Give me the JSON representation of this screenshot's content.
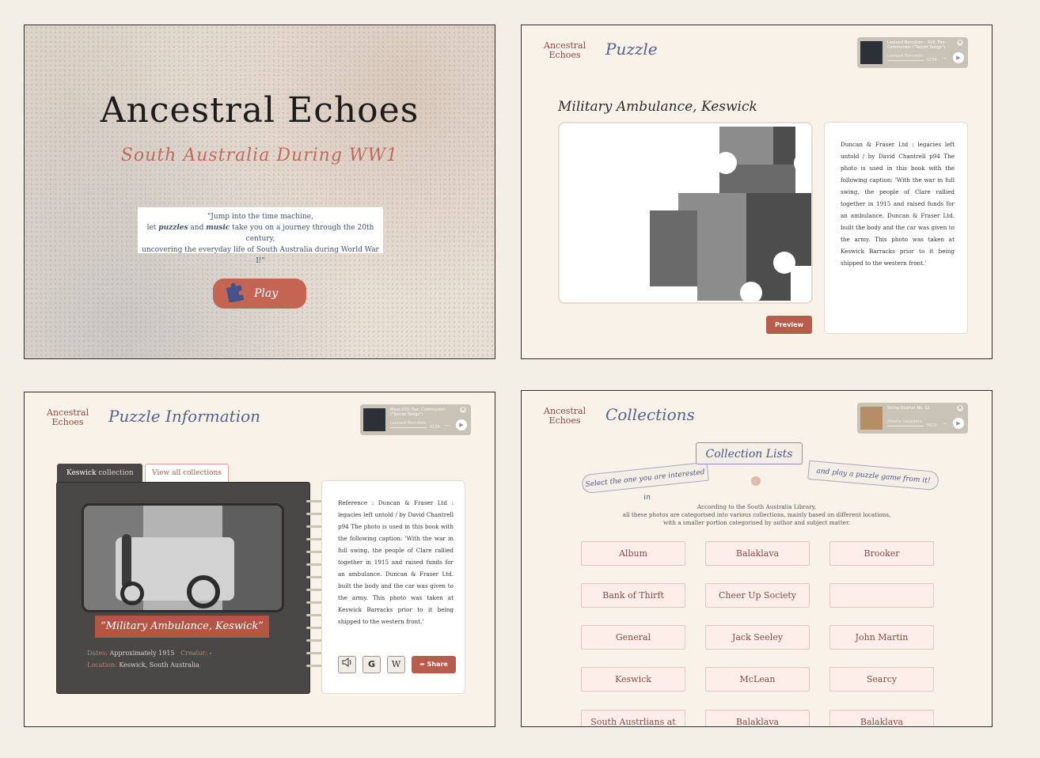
{
  "landing": {
    "title": "Ancestral Echoes",
    "subtitle": "South Australia During WW1",
    "quote_line1": "\"Jump into the time machine,",
    "quote_line2_pre": "let ",
    "quote_puzzles": "puzzles",
    "quote_and": " and ",
    "quote_music": "music",
    "quote_line2_post": " take you on a journey through the 20th century,",
    "quote_line3": "uncovering the everyday life of South Australia during World War I!\"",
    "play_label": "Play"
  },
  "logo": {
    "line1": "Ancestral",
    "line2": "Echoes"
  },
  "puzzle": {
    "page_title": "Puzzle",
    "heading": "Military Ambulance, Keswick",
    "description": "Duncan & Fraser Ltd : legacies left untold / by David Chantrell p94 The photo is used in this book with the following caption: 'With the war in full swing, the people of Clare rallied together in 1915 and raised funds for an ambulance. Duncan & Fraser Ltd. built the body and the car was given to the army. This photo was taken at Keswick Barracks prior to it being shipped to the western front.'",
    "preview_label": "Preview",
    "player": {
      "title": "Leonard Bernstein - XVII. Pax: Communion (\"Secret Songs\")",
      "artist": "Leonard Bernstein",
      "time": "0234",
      "more": "···"
    }
  },
  "info": {
    "page_title": "Puzzle Information",
    "tab_active_name": "Keswick",
    "tab_active_suffix": "collection",
    "tab_link": "View all collections",
    "photo_title": "“Military Ambulance, Keswick”",
    "dates_label": "Dates:",
    "dates_value": "Approximately 1915",
    "creator_label": "Creator:",
    "creator_value": "-",
    "location_label": "Location:",
    "location_value": "Keswick, South Australia",
    "reference": "Reference : Duncan & Fraser Ltd : legacies left untold / by David Chantrell p94 The photo is used in this book with the following caption: 'With the war in full swing, the people of Clare rallied together in 1915 and raised funds for an ambulance. Duncan & Fraser Ltd. built the body and the car was given to the army. This photo was taken at Keswick Barracks prior to it being shipped to the western front.'",
    "btn_google": "G",
    "btn_wiki": "W",
    "share_label": "Share",
    "player": {
      "title": "Mass XVII. Pax: Communion (\"Secret Songs\")",
      "artist": "Leonard Bernstein",
      "time": "0234",
      "more": "···"
    }
  },
  "collections": {
    "page_title": "Collections",
    "banner_title": "Collection Lists",
    "banner_left": "Select the one you are interested in",
    "banner_right": "and play a puzzle game from it!",
    "intro_line1": "According to the South Australia Library,",
    "intro_line2": "all these photos are categorised into various collections, mainly based on different locations,",
    "intro_line3": "with a smaller portion categorised by author and subject matter.",
    "items": [
      "Album",
      "Balaklava",
      "Brooker",
      "Bank of Thirft",
      "Cheer Up Society",
      "",
      "General",
      "Jack Seeley",
      "John Martin",
      "Keswick",
      "McLean",
      "Searcy",
      "South Austrlians at War",
      "Balaklava",
      "Balaklava"
    ],
    "player": {
      "title": "String Quartet No. 12",
      "artist": "Alberto Ginastera",
      "time": "0820",
      "more": "···"
    }
  },
  "colors": {
    "accent": "#b85c4c",
    "script_blue": "#55628f",
    "logo_brown": "#8a4b43",
    "panel_bg": "#f8f2e8"
  }
}
